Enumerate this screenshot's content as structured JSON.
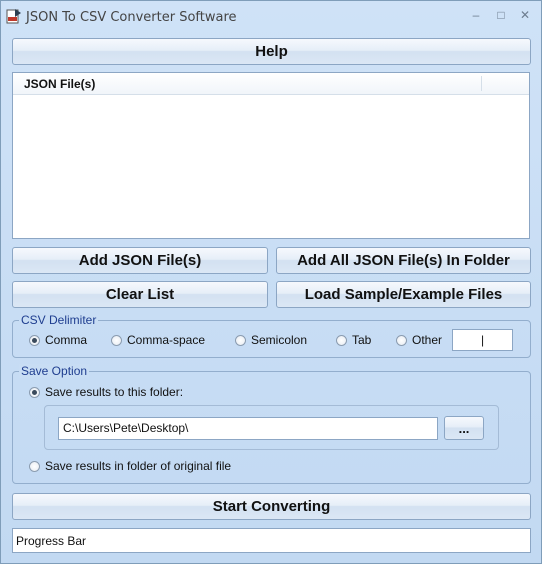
{
  "window": {
    "title": "JSON To CSV Converter Software"
  },
  "buttons": {
    "help": "Help",
    "add_files": "Add JSON File(s)",
    "add_folder": "Add All JSON File(s) In Folder",
    "clear_list": "Clear List",
    "load_sample": "Load Sample/Example Files",
    "browse": "...",
    "start": "Start Converting"
  },
  "file_list": {
    "column_header": "JSON File(s)",
    "items": []
  },
  "csv_delimiter": {
    "title": "CSV Delimiter",
    "options": [
      "Comma",
      "Comma-space",
      "Semicolon",
      "Tab",
      "Other"
    ],
    "selected": "Comma",
    "other_value": "|"
  },
  "save_option": {
    "title": "Save Option",
    "option_folder": "Save results to this folder:",
    "folder_path": "C:\\Users\\Pete\\Desktop\\",
    "option_original": "Save results in folder of original file",
    "selected": "folder"
  },
  "progress": {
    "label": "Progress Bar"
  },
  "icons": {
    "app": "converter-app-icon",
    "minimize": "minimize-icon",
    "maximize": "maximize-icon",
    "close": "close-icon"
  }
}
